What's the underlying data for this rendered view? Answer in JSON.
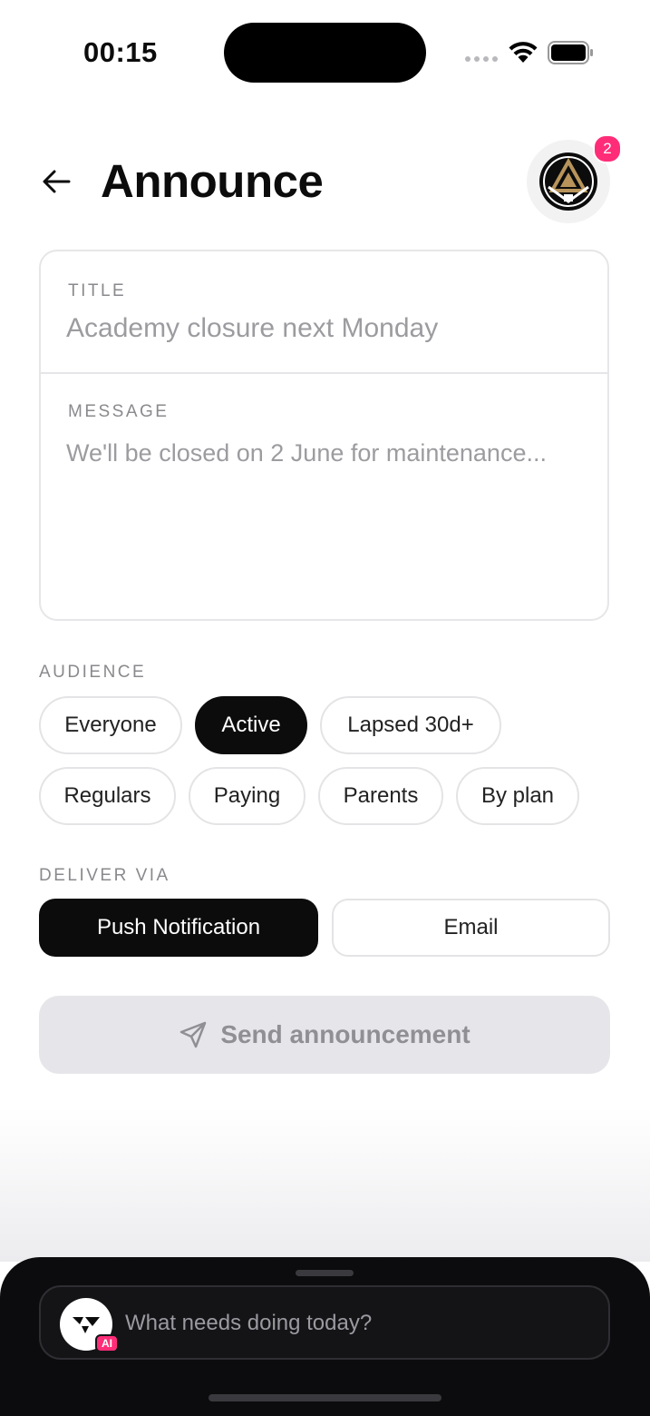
{
  "status_bar": {
    "time": "00:15"
  },
  "header": {
    "title": "Announce",
    "notification_count": "2"
  },
  "form": {
    "title_label": "TITLE",
    "title_placeholder": "Academy closure next Monday",
    "message_label": "MESSAGE",
    "message_placeholder": "We'll be closed on 2 June for maintenance..."
  },
  "audience": {
    "label": "AUDIENCE",
    "options": [
      {
        "label": "Everyone",
        "selected": false
      },
      {
        "label": "Active",
        "selected": true
      },
      {
        "label": "Lapsed 30d+",
        "selected": false
      },
      {
        "label": "Regulars",
        "selected": false
      },
      {
        "label": "Paying",
        "selected": false
      },
      {
        "label": "Parents",
        "selected": false
      },
      {
        "label": "By plan",
        "selected": false
      }
    ]
  },
  "deliver": {
    "label": "DELIVER VIA",
    "options": [
      {
        "label": "Push Notification",
        "selected": true
      },
      {
        "label": "Email",
        "selected": false
      }
    ]
  },
  "send": {
    "label": "Send announcement",
    "enabled": false
  },
  "assistant": {
    "tag": "AI",
    "placeholder": "What needs doing today?"
  },
  "colors": {
    "accent": "#0c0c0d",
    "badge": "#ff2d78",
    "logo_gold": "#b8945a"
  }
}
